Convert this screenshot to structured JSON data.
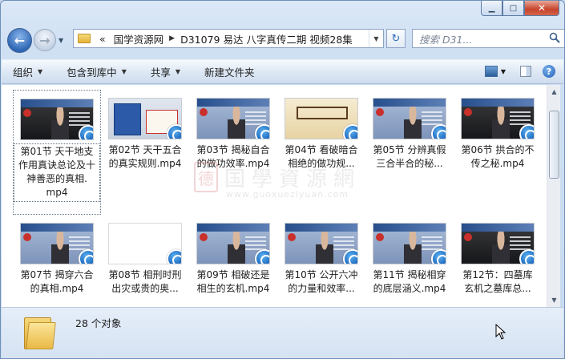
{
  "window": {
    "caption_buttons": {
      "minimize": "▁",
      "maximize": "□",
      "close": "✕"
    }
  },
  "navigation": {
    "address_prefix": "«",
    "breadcrumbs": [
      "国学资源网",
      "D31079 易达 八字真传二期 视频28集"
    ],
    "search_placeholder": "搜索 D31...",
    "refresh_glyph": "↻"
  },
  "toolbar": {
    "items": [
      {
        "label": "组织",
        "dropdown": true
      },
      {
        "label": "包含到库中",
        "dropdown": true
      },
      {
        "label": "共享",
        "dropdown": true
      },
      {
        "label": "新建文件夹",
        "dropdown": false
      }
    ],
    "help_glyph": "?"
  },
  "files": [
    {
      "name": "第01节 天干地支作用真诀总论及十神善恶的真相.mp4",
      "lines": [
        "第01节 天干地支",
        "作用真诀总论及十",
        "神善恶的真相.",
        "mp4"
      ],
      "thumb": "dark",
      "selected": true
    },
    {
      "name": "第02节 天干五合的真实规则.mp4",
      "lines": [
        "第02节 天干五合",
        "的真实规则.mp4"
      ],
      "thumb": "cert",
      "selected": false
    },
    {
      "name": "第03节 揭秘自合的做功效率.mp4",
      "lines": [
        "第03节 揭秘自合",
        "的做功效率.mp4"
      ],
      "thumb": "blue",
      "selected": false
    },
    {
      "name": "第04节 看破暗合相绝的做功规...",
      "lines": [
        "第04节 看破暗合",
        "相绝的做功规..."
      ],
      "thumb": "scroll",
      "selected": false
    },
    {
      "name": "第05节 分辨真假三合半合的秘...",
      "lines": [
        "第05节 分辨真假",
        "三合半合的秘..."
      ],
      "thumb": "blue",
      "selected": false
    },
    {
      "name": "第06节 拱合的不传之秘.mp4",
      "lines": [
        "第06节 拱合的不",
        "传之秘.mp4"
      ],
      "thumb": "dark",
      "selected": false
    },
    {
      "name": "第07节 揭穿六合的真相.mp4",
      "lines": [
        "第07节 揭穿六合",
        "的真相.mp4"
      ],
      "thumb": "blue",
      "selected": false
    },
    {
      "name": "第08节 相刑时刑出灾或贵的奥...",
      "lines": [
        "第08节 相刑时刑",
        "出灾或贵的奥..."
      ],
      "thumb": "white",
      "selected": false
    },
    {
      "name": "第09节 相破还是相生的玄机.mp4",
      "lines": [
        "第09节 相破还是",
        "相生的玄机.mp4"
      ],
      "thumb": "blue",
      "selected": false
    },
    {
      "name": "第10节 公开六冲的力量和效率...",
      "lines": [
        "第10节 公开六冲",
        "的力量和效率..."
      ],
      "thumb": "blue",
      "selected": false
    },
    {
      "name": "第11节 揭秘相穿的底层涵义.mp4",
      "lines": [
        "第11节 揭秘相穿",
        "的底层涵义.mp4"
      ],
      "thumb": "blue",
      "selected": false
    },
    {
      "name": "第12节：四墓库玄机之墓库总...",
      "lines": [
        "第12节：四墓库",
        "玄机之墓库总..."
      ],
      "thumb": "dark",
      "selected": false
    }
  ],
  "watermark": {
    "seal": "德",
    "text": "国學資源網",
    "url": "www.guoxueziyuan.com"
  },
  "status": {
    "item_count": "28 个对象"
  },
  "colors": {
    "accent": "#2f67b5",
    "close_button": "#c7432c",
    "selection_border": "#6c7a8c"
  }
}
